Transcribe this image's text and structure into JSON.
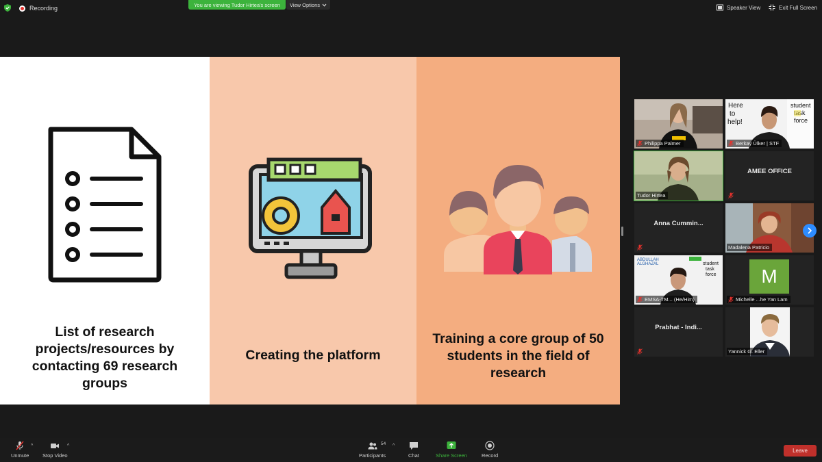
{
  "topbar": {
    "recording_label": "Recording",
    "viewing_label": "You are viewing Tudor Hirtea's screen",
    "view_options_label": "View Options",
    "speaker_view_label": "Speaker View",
    "exit_full_screen_label": "Exit Full Screen"
  },
  "slide": {
    "panels": [
      {
        "caption": "List of research projects/resources by contacting 69 research groups",
        "icon": "document-list-icon",
        "bg": "#ffffff"
      },
      {
        "caption": "Creating the platform",
        "icon": "platform-monitor-icon",
        "bg": "#f8c8ab"
      },
      {
        "caption": "Training a core group of 50 students in the field of research",
        "icon": "group-people-icon",
        "bg": "#f4ad80"
      }
    ]
  },
  "gallery": {
    "tiles": [
      {
        "name": "Philippa Palmer",
        "type": "video"
      },
      {
        "name": "Berkay Ülker | STF",
        "type": "video"
      },
      {
        "name": "Tudor Hirtea",
        "type": "video",
        "active": true
      },
      {
        "name": "AMEE OFFICE",
        "type": "name-only"
      },
      {
        "name": "Anna Cummin...",
        "type": "name-only"
      },
      {
        "name": "Madalena Patricio",
        "type": "video"
      },
      {
        "name": "EMSA-TM... (He/Him)",
        "type": "video"
      },
      {
        "name": "Michelle ...he Yan Lam",
        "type": "avatar",
        "avatar_letter": "M"
      },
      {
        "name": "Prabhat - Indi...",
        "type": "name-only"
      },
      {
        "name": "Yannick G. Eller",
        "type": "video"
      }
    ]
  },
  "toolbar": {
    "unmute_label": "Unmute",
    "stop_video_label": "Stop Video",
    "participants_label": "Participants",
    "participants_count": "54",
    "chat_label": "Chat",
    "share_screen_label": "Share Screen",
    "record_label": "Record",
    "leave_label": "Leave"
  },
  "colors": {
    "accent_green": "#3cb33c",
    "leave_red": "#c0302b",
    "next_blue": "#2d8cff"
  }
}
